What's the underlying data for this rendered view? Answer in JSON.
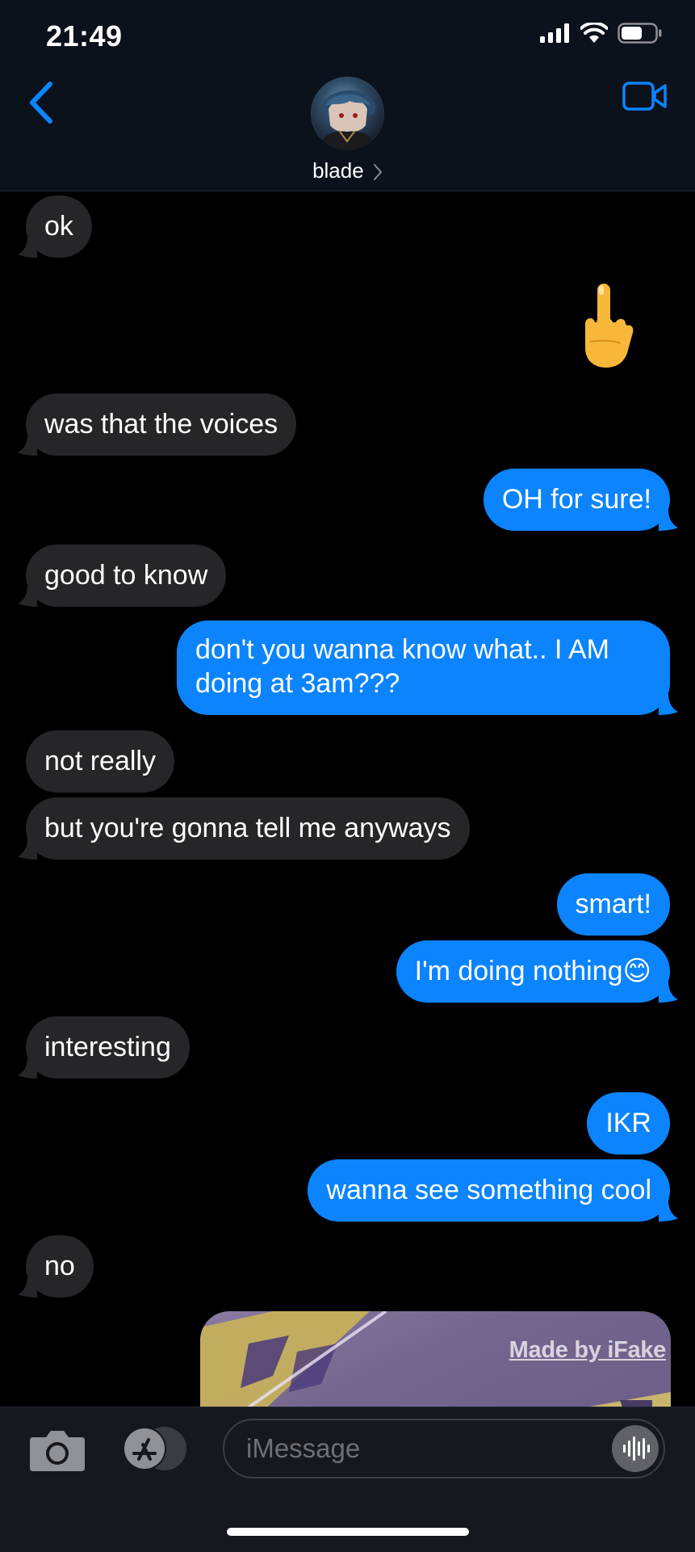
{
  "status_bar": {
    "time": "21:49"
  },
  "header": {
    "contact_name": "blade",
    "back_icon": "chevron-left-icon",
    "video_icon": "video-camera-icon",
    "accent_color": "#0a84ff"
  },
  "messages": [
    {
      "sender": "them",
      "text": "ok"
    },
    {
      "sender": "me",
      "text": "🖕"
    },
    {
      "sender": "them",
      "text": "was that the voices"
    },
    {
      "sender": "me",
      "text": "OH for sure!"
    },
    {
      "sender": "them",
      "text": "good to know"
    },
    {
      "sender": "me",
      "text": "don't you wanna know what.. I AM doing at 3am???"
    },
    {
      "sender": "them",
      "text": "not really"
    },
    {
      "sender": "them",
      "text": "but you're gonna tell me anyways"
    },
    {
      "sender": "me",
      "text": "smart!"
    },
    {
      "sender": "me",
      "text": "I'm doing nothing😊"
    },
    {
      "sender": "them",
      "text": "interesting"
    },
    {
      "sender": "me",
      "text": "IKR"
    },
    {
      "sender": "me",
      "text": "wanna see something cool"
    },
    {
      "sender": "them",
      "text": "no"
    },
    {
      "sender": "me",
      "type": "image",
      "watermark": "Made by iFake"
    }
  ],
  "input_bar": {
    "placeholder": "iMessage",
    "camera_icon": "camera-icon",
    "apps_icon": "app-store-icon",
    "audio_icon": "waveform-icon"
  },
  "colors": {
    "incoming_bubble": "#262629",
    "outgoing_bubble": "#0b84fe",
    "background": "#000000"
  }
}
